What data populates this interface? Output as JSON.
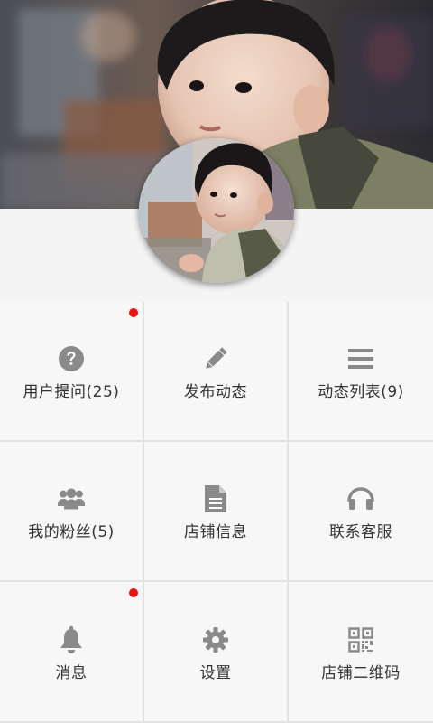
{
  "colors": {
    "icon": "#8a8a8a",
    "label": "#333333",
    "badge_dot": "#ee1111",
    "cell_bg": "#f7f7f7",
    "divider": "#e2e2e2"
  },
  "profile": {
    "banner": "child-photo-banner",
    "avatar": "child-avatar-photo"
  },
  "menu": [
    {
      "label": "用户提问(25)",
      "icon": "question-circle-icon",
      "badge": true
    },
    {
      "label": "发布动态",
      "icon": "pencil-icon",
      "badge": false
    },
    {
      "label": "动态列表(9)",
      "icon": "list-icon",
      "badge": false
    },
    {
      "label": "我的粉丝(5)",
      "icon": "users-icon",
      "badge": false
    },
    {
      "label": "店铺信息",
      "icon": "document-icon",
      "badge": false
    },
    {
      "label": "联系客服",
      "icon": "headset-icon",
      "badge": false
    },
    {
      "label": "消息",
      "icon": "bell-icon",
      "badge": true
    },
    {
      "label": "设置",
      "icon": "gear-icon",
      "badge": false
    },
    {
      "label": "店铺二维码",
      "icon": "qr-code-icon",
      "badge": false
    }
  ]
}
